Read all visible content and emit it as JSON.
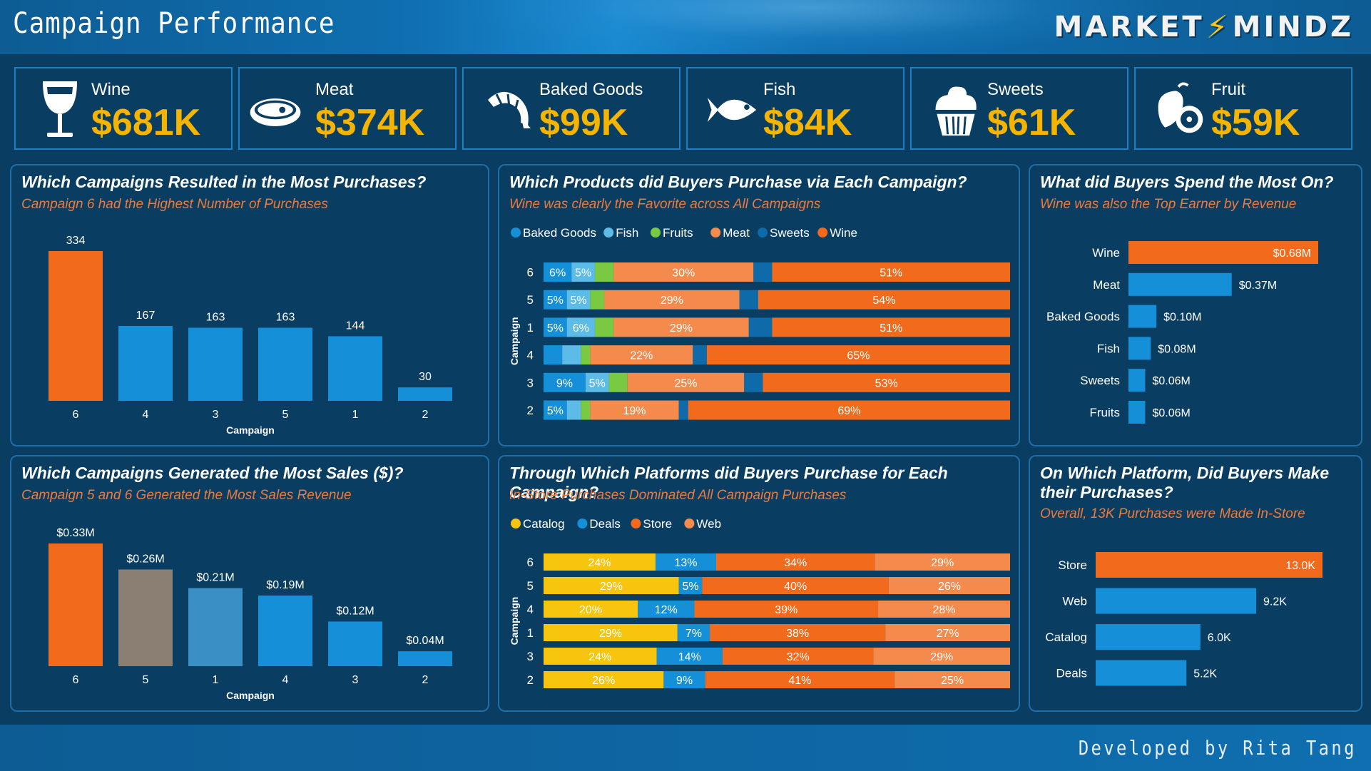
{
  "header": {
    "title": "Campaign Performance",
    "brand_left": "MARKET",
    "brand_right": "MINDZ"
  },
  "footer": {
    "credit": "Developed by Rita Tang"
  },
  "colors": {
    "orange": "#f26a1b",
    "blue": "#1590d8",
    "light_blue": "#5dbbe8",
    "green": "#7ac943",
    "salmon": "#f48a4c",
    "dark_blue": "#0e6aa8",
    "yellow": "#f7c40e",
    "taupe": "#8a7f72",
    "steel": "#3a8fc4",
    "accent_text": "#f5b400"
  },
  "kpis": [
    {
      "label": "Wine",
      "value": "$681K",
      "icon": "wine-glass-icon"
    },
    {
      "label": "Meat",
      "value": "$374K",
      "icon": "steak-icon"
    },
    {
      "label": "Baked Goods",
      "value": "$99K",
      "icon": "croissant-icon"
    },
    {
      "label": "Fish",
      "value": "$84K",
      "icon": "fish-icon"
    },
    {
      "label": "Sweets",
      "value": "$61K",
      "icon": "cupcake-icon"
    },
    {
      "label": "Fruit",
      "value": "$59K",
      "icon": "fruit-icon"
    }
  ],
  "panels": {
    "purchases": {
      "title": "Which Campaigns Resulted in the Most Purchases?",
      "subtitle": "Campaign 6 had the Highest Number of Purchases"
    },
    "products": {
      "title": "Which Products did Buyers Purchase via Each Campaign?",
      "subtitle": "Wine was clearly the Favorite across All Campaigns"
    },
    "spend": {
      "title": "What did Buyers Spend the Most On?",
      "subtitle": "Wine was also the Top Earner by Revenue"
    },
    "sales": {
      "title": "Which Campaigns Generated the Most Sales ($)?",
      "subtitle": "Campaign 5 and 6 Generated the Most Sales Revenue"
    },
    "platforms": {
      "title": "Through Which Platforms did Buyers Purchase for Each Campaign?",
      "subtitle": "In-Store Purchases Dominated All Campaign Purchases"
    },
    "platform_total": {
      "title": "On Which Platform, Did Buyers Make their Purchases?",
      "subtitle": "Overall, 13K Purchases were Made In-Store"
    }
  },
  "chart_data": [
    {
      "id": "purchases",
      "type": "bar",
      "xlabel": "Campaign",
      "categories": [
        "6",
        "4",
        "3",
        "5",
        "1",
        "2"
      ],
      "values": [
        334,
        167,
        163,
        163,
        144,
        30
      ],
      "labels": [
        "334",
        "167",
        "163",
        "163",
        "144",
        "30"
      ],
      "colors": [
        "#f26a1b",
        "#1590d8",
        "#1590d8",
        "#1590d8",
        "#1590d8",
        "#1590d8"
      ],
      "ylim": [
        0,
        334
      ]
    },
    {
      "id": "products",
      "type": "bar",
      "orientation": "horizontal-stacked-100",
      "ylabel": "Campaign",
      "legend": [
        "Baked Goods",
        "Fish",
        "Fruits",
        "Meat",
        "Sweets",
        "Wine"
      ],
      "series_colors": [
        "#1590d8",
        "#5dbbe8",
        "#7ac943",
        "#f48a4c",
        "#0e6aa8",
        "#f26a1b"
      ],
      "categories": [
        "6",
        "5",
        "1",
        "4",
        "3",
        "2"
      ],
      "values": [
        [
          6,
          5,
          4,
          30,
          4,
          51
        ],
        [
          5,
          5,
          3,
          29,
          4,
          54
        ],
        [
          5,
          6,
          4,
          29,
          5,
          51
        ],
        [
          4,
          4,
          2,
          22,
          3,
          65
        ],
        [
          9,
          5,
          4,
          25,
          4,
          53
        ],
        [
          5,
          3,
          2,
          19,
          2,
          69
        ]
      ],
      "labels": [
        [
          "6%",
          "5%",
          "",
          "30%",
          "",
          "51%"
        ],
        [
          "5%",
          "5%",
          "",
          "29%",
          "",
          "54%"
        ],
        [
          "5%",
          "6%",
          "",
          "29%",
          "",
          "51%"
        ],
        [
          "",
          "",
          "",
          "22%",
          "",
          "65%"
        ],
        [
          "9%",
          "5%",
          "",
          "25%",
          "",
          "53%"
        ],
        [
          "5%",
          "",
          "",
          "19%",
          "",
          "69%"
        ]
      ]
    },
    {
      "id": "spend",
      "type": "bar",
      "orientation": "horizontal",
      "categories": [
        "Wine",
        "Meat",
        "Baked Goods",
        "Fish",
        "Sweets",
        "Fruits"
      ],
      "values": [
        0.68,
        0.37,
        0.1,
        0.08,
        0.06,
        0.06
      ],
      "labels": [
        "$0.68M",
        "$0.37M",
        "$0.10M",
        "$0.08M",
        "$0.06M",
        "$0.06M"
      ],
      "colors": [
        "#f26a1b",
        "#1590d8",
        "#1590d8",
        "#1590d8",
        "#1590d8",
        "#1590d8"
      ],
      "xlim": [
        0,
        0.68
      ]
    },
    {
      "id": "sales",
      "type": "bar",
      "xlabel": "Campaign",
      "categories": [
        "6",
        "5",
        "1",
        "4",
        "3",
        "2"
      ],
      "values": [
        0.33,
        0.26,
        0.21,
        0.19,
        0.12,
        0.04
      ],
      "labels": [
        "$0.33M",
        "$0.26M",
        "$0.21M",
        "$0.19M",
        "$0.12M",
        "$0.04M"
      ],
      "colors": [
        "#f26a1b",
        "#8a7f72",
        "#3a8fc4",
        "#1590d8",
        "#1590d8",
        "#1590d8"
      ],
      "ylim": [
        0,
        0.33
      ]
    },
    {
      "id": "platforms",
      "type": "bar",
      "orientation": "horizontal-stacked-100",
      "ylabel": "Campaign",
      "legend": [
        "Catalog",
        "Deals",
        "Store",
        "Web"
      ],
      "series_colors": [
        "#f7c40e",
        "#1590d8",
        "#f26a1b",
        "#f48a4c"
      ],
      "categories": [
        "6",
        "5",
        "4",
        "1",
        "3",
        "2"
      ],
      "values": [
        [
          24,
          13,
          34,
          29
        ],
        [
          29,
          5,
          40,
          26
        ],
        [
          20,
          12,
          39,
          28
        ],
        [
          29,
          7,
          38,
          27
        ],
        [
          24,
          14,
          32,
          29
        ],
        [
          26,
          9,
          41,
          25
        ]
      ],
      "labels": [
        [
          "24%",
          "13%",
          "34%",
          "29%"
        ],
        [
          "29%",
          "5%",
          "40%",
          "26%"
        ],
        [
          "20%",
          "12%",
          "39%",
          "28%"
        ],
        [
          "29%",
          "7%",
          "38%",
          "27%"
        ],
        [
          "24%",
          "14%",
          "32%",
          "29%"
        ],
        [
          "26%",
          "9%",
          "41%",
          "25%"
        ]
      ]
    },
    {
      "id": "platform_total",
      "type": "bar",
      "orientation": "horizontal",
      "categories": [
        "Store",
        "Web",
        "Catalog",
        "Deals"
      ],
      "values": [
        13.0,
        9.2,
        6.0,
        5.2
      ],
      "labels": [
        "13.0K",
        "9.2K",
        "6.0K",
        "5.2K"
      ],
      "colors": [
        "#f26a1b",
        "#1590d8",
        "#1590d8",
        "#1590d8"
      ],
      "xlim": [
        0,
        13.0
      ]
    }
  ]
}
